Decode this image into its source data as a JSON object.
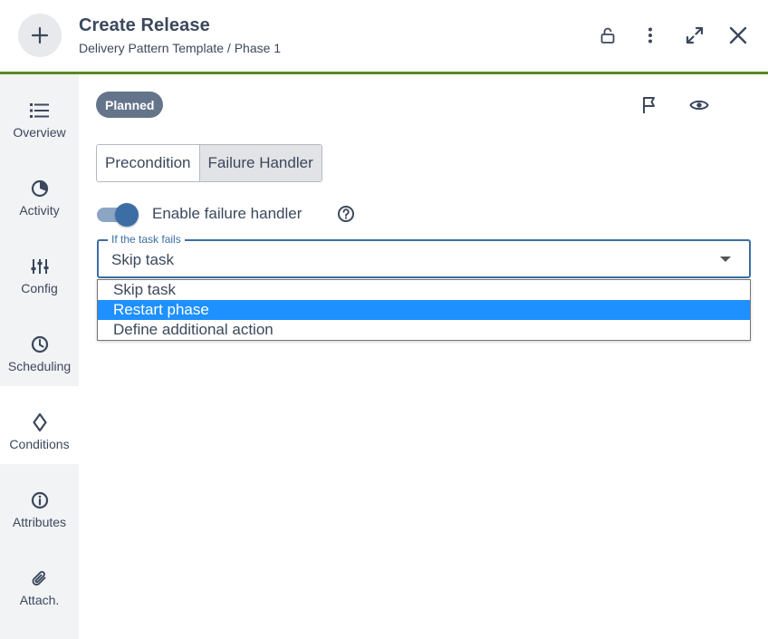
{
  "header": {
    "title": "Create Release",
    "subtitle": "Delivery Pattern Template / Phase 1",
    "accent_color": "#5a8a1f",
    "icons": [
      "plus-icon",
      "unlock-icon",
      "more-vertical-icon",
      "expand-icon",
      "close-icon"
    ]
  },
  "sidebar": {
    "items": [
      {
        "label": "Overview",
        "icon": "list-icon"
      },
      {
        "label": "Activity",
        "icon": "pie-chart-icon"
      },
      {
        "label": "Config",
        "icon": "sliders-icon"
      },
      {
        "label": "Scheduling",
        "icon": "clock-icon"
      },
      {
        "label": "Conditions",
        "icon": "diamond-icon",
        "active": true
      },
      {
        "label": "Attributes",
        "icon": "info-icon"
      },
      {
        "label": "Attach.",
        "icon": "paperclip-icon"
      }
    ]
  },
  "main": {
    "status_badge": "Planned",
    "tabs": [
      {
        "label": "Precondition",
        "selected": false
      },
      {
        "label": "Failure Handler",
        "selected": true
      }
    ],
    "toggle": {
      "label": "Enable failure handler",
      "on": true
    },
    "select": {
      "legend": "If the task fails",
      "value": "Skip task",
      "options": [
        "Skip task",
        "Restart phase",
        "Define additional action"
      ],
      "highlighted_option": "Restart phase",
      "highlight_color": "#1e90ff"
    }
  }
}
